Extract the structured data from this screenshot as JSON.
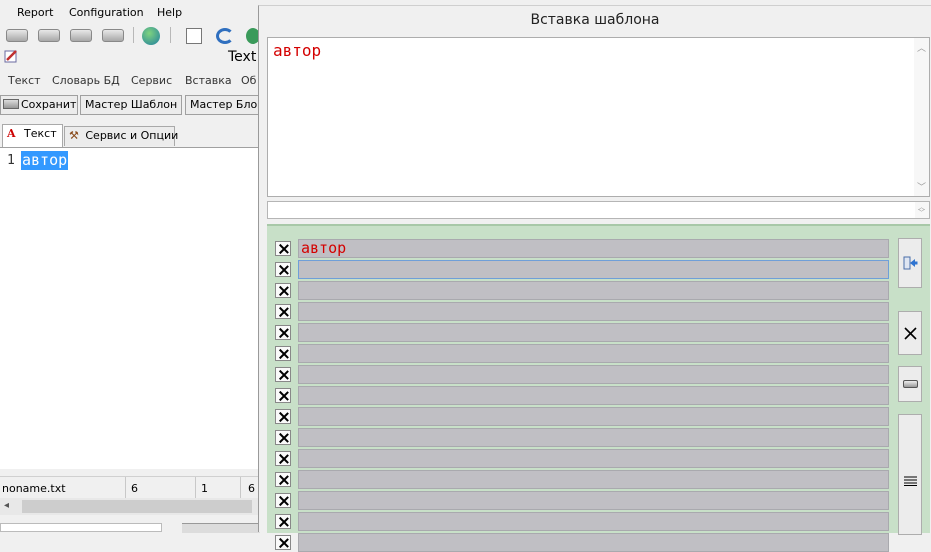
{
  "app": {
    "menu": [
      "Report",
      "Configuration",
      "Help"
    ],
    "text_window": {
      "title": "Text",
      "menu": [
        "Текст",
        "Словарь БД",
        "Сервис",
        "Вставка",
        "Об"
      ],
      "buttons": [
        "Сохранить",
        "Мастер Шаблон {}",
        "Мастер БлокV"
      ],
      "tabs": [
        "Текст",
        "Сервис и Опции"
      ],
      "editor": {
        "line_number": "1",
        "content": "автор"
      },
      "status": {
        "file": "noname.txt",
        "col_a": "6",
        "col_b": "1",
        "col_c": "6"
      }
    }
  },
  "dialog": {
    "title": "Вставка шаблона",
    "preview_text": "автор",
    "template_rows": [
      "автор",
      "",
      "",
      "",
      "",
      "",
      "",
      "",
      "",
      "",
      "",
      "",
      "",
      "",
      ""
    ]
  },
  "colors": {
    "template_text": "#d40000",
    "selection": "#3399ff",
    "panel_bg": "#c8e0c8"
  },
  "icons": [
    "edit-icon",
    "letter-a-icon",
    "tools-icon",
    "save-icon",
    "insert-icon",
    "delete-icon",
    "keyboard-icon",
    "align-icon",
    "globe-icon",
    "printer-icon"
  ]
}
